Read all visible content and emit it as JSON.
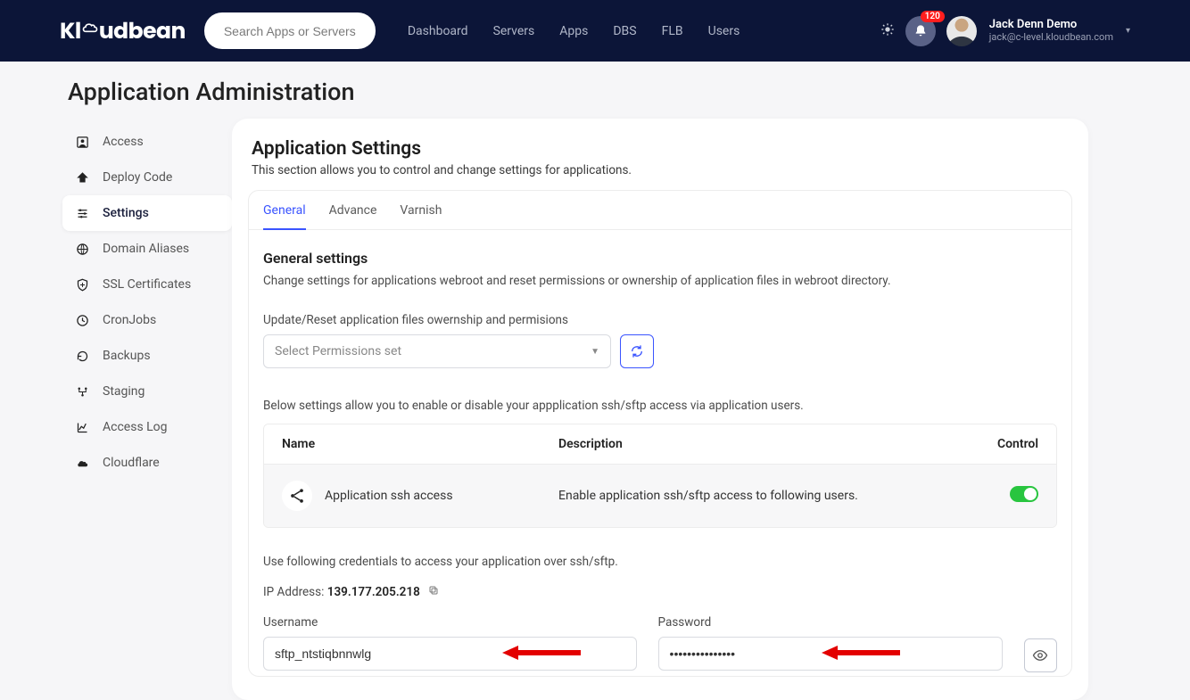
{
  "header": {
    "logo_text": "Kloudbean",
    "search_placeholder": "Search Apps or Servers",
    "nav": [
      "Dashboard",
      "Servers",
      "Apps",
      "DBS",
      "FLB",
      "Users"
    ],
    "notif_count": "120",
    "user_name": "Jack Denn Demo",
    "user_email": "jack@c-level.kloudbean.com"
  },
  "page_title": "Application Administration",
  "sidebar": [
    {
      "label": "Access",
      "icon": "contact-icon"
    },
    {
      "label": "Deploy Code",
      "icon": "deploy-icon"
    },
    {
      "label": "Settings",
      "icon": "settings-icon",
      "active": true
    },
    {
      "label": "Domain Aliases",
      "icon": "globe-icon"
    },
    {
      "label": "SSL Certificates",
      "icon": "shield-icon"
    },
    {
      "label": "CronJobs",
      "icon": "clock-icon"
    },
    {
      "label": "Backups",
      "icon": "backup-icon"
    },
    {
      "label": "Staging",
      "icon": "staging-icon"
    },
    {
      "label": "Access Log",
      "icon": "chart-icon"
    },
    {
      "label": "Cloudflare",
      "icon": "cloud-icon"
    }
  ],
  "settings": {
    "title": "Application Settings",
    "subtitle": "This section allows you to control and change settings for applications.",
    "tabs": [
      "General",
      "Advance",
      "Varnish"
    ],
    "general": {
      "heading": "General settings",
      "sub": "Change settings for applications webroot and reset permissions or ownership of application files in webroot directory.",
      "perm_label": "Update/Reset application files owernship and permisions",
      "select_placeholder": "Select Permissions set",
      "access_note": "Below settings allow you to enable or disable your appplication ssh/sftp access via application users.",
      "table_cols": {
        "name": "Name",
        "desc": "Description",
        "ctrl": "Control"
      },
      "row": {
        "name": "Application ssh access",
        "desc": "Enable application ssh/sftp access to following users."
      },
      "creds_note": "Use following credentials to access your application over ssh/sftp.",
      "ip_prefix": "IP Address: ",
      "ip_value": "139.177.205.218",
      "username_label": "Username",
      "username_value": "sftp_ntstiqbnnwlg",
      "password_label": "Password",
      "password_value": "•••••••••••••••"
    }
  }
}
